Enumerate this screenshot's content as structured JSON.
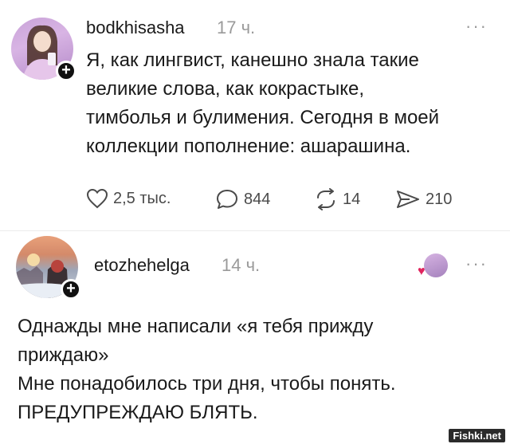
{
  "posts": [
    {
      "username": "bodkhisasha",
      "time": "17 ч.",
      "text_lines": [
        "Я, как лингвист, канешно знала такие",
        "великие слова, как кокрастыке,",
        "тимболья и булимения. Сегодня в моей",
        "коллекции пополнение: ашарашина."
      ],
      "stats": {
        "likes": "2,5 тыс.",
        "comments": "844",
        "reposts": "14",
        "shares": "210"
      }
    },
    {
      "username": "etozhehelga",
      "time": "14 ч.",
      "text_lines": [
        "Однажды мне написали «я тебя прижду",
        "приждаю»",
        "Мне понадобилось три дня, чтобы понять.",
        "ПРЕДУПРЕЖДАЮ БЛЯТЬ."
      ]
    }
  ],
  "more_glyph": "···",
  "plus_glyph": "+",
  "watermark": "Fishki.net",
  "icons": {
    "like": "heart-icon",
    "comment": "comment-bubble-icon",
    "repost": "repost-arrows-icon",
    "share": "send-arrow-icon"
  },
  "colors": {
    "text": "#1a1a1a",
    "muted": "#9a9a9a",
    "liked_heart": "#e0245e"
  }
}
